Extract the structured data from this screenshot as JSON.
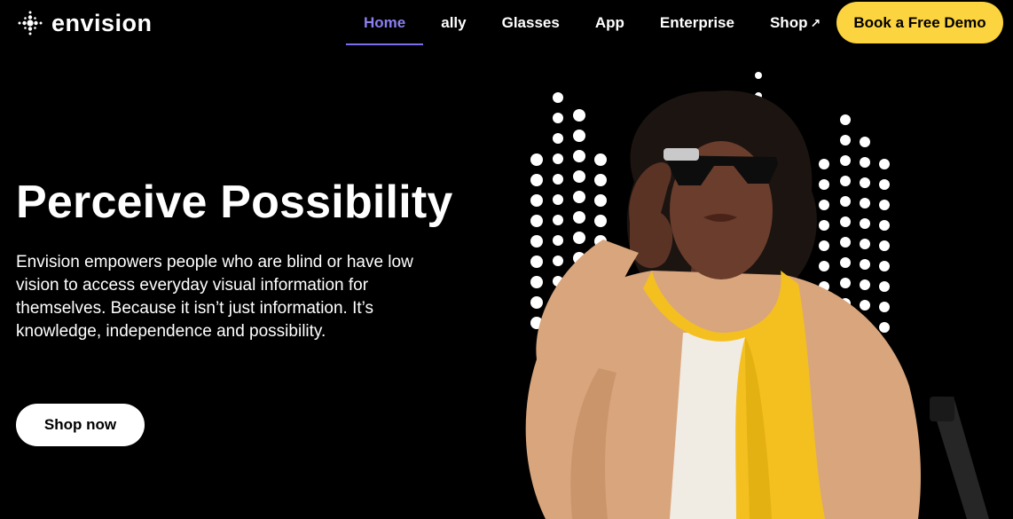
{
  "header": {
    "logo_text": "envision",
    "nav": [
      {
        "label": "Home",
        "active": true
      },
      {
        "label": "ally",
        "active": false
      },
      {
        "label": "Glasses",
        "active": false
      },
      {
        "label": "App",
        "active": false
      },
      {
        "label": "Enterprise",
        "active": false
      },
      {
        "label": "Shop",
        "active": false,
        "icon": "external-arrow-icon",
        "icon_glyph": "↗"
      }
    ],
    "cta_label": "Book a Free Demo"
  },
  "hero": {
    "title": "Perceive Possibility",
    "description": "Envision empowers people who are blind or have low vision to access everyday visual information for themselves. Because it isn’t just information. It’s knowledge, independence and possibility.",
    "button_label": "Shop now"
  },
  "colors": {
    "background": "#000000",
    "accent_purple": "#7b6ff0",
    "cta_yellow": "#fcd43f",
    "scarf_yellow": "#f4c020",
    "coat_tan": "#d9a57c"
  }
}
